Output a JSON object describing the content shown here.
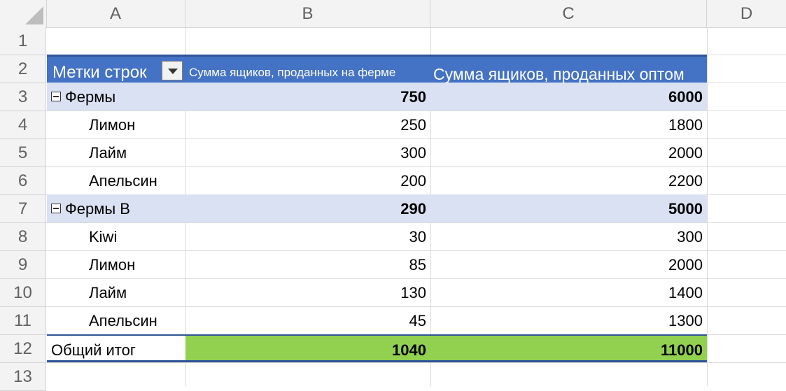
{
  "columns": [
    "A",
    "B",
    "C",
    "D"
  ],
  "rows": [
    "1",
    "2",
    "3",
    "4",
    "5",
    "6",
    "7",
    "8",
    "9",
    "10",
    "11",
    "12",
    "13"
  ],
  "pivot": {
    "header": {
      "row_labels": "Метки строк",
      "col_b": "Сумма ящиков, проданных на ферме",
      "col_c": "Сумма ящиков, проданных оптом"
    },
    "groups": [
      {
        "name": "Фермы",
        "b": "750",
        "c": "6000",
        "items": [
          {
            "name": "Лимон",
            "b": "250",
            "c": "1800"
          },
          {
            "name": "Лайм",
            "b": "300",
            "c": "2000"
          },
          {
            "name": "Апельсин",
            "b": "200",
            "c": "2200"
          }
        ]
      },
      {
        "name": "Фермы В",
        "b": "290",
        "c": "5000",
        "items": [
          {
            "name": "Kiwi",
            "b": "30",
            "c": "300"
          },
          {
            "name": "Лимон",
            "b": "85",
            "c": "2000"
          },
          {
            "name": "Лайм",
            "b": "130",
            "c": "1400"
          },
          {
            "name": "Апельсин",
            "b": "45",
            "c": "1300"
          }
        ]
      }
    ],
    "total": {
      "label": "Общий итог",
      "b": "1040",
      "c": "11000"
    }
  },
  "colors": {
    "header_fill": "#4472c4",
    "group_fill": "#d9e1f2",
    "total_fill": "#92d050"
  }
}
